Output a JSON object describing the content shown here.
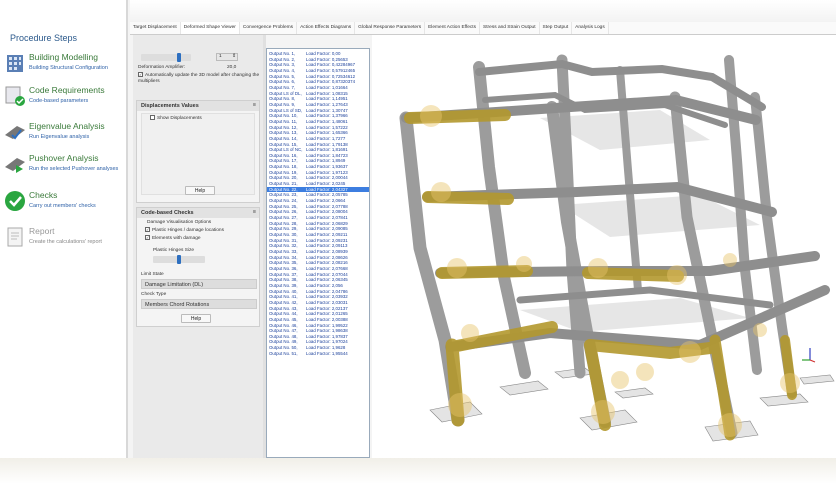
{
  "sidebar": {
    "title": "Procedure Steps",
    "steps": [
      {
        "title": "Building Modelling",
        "subtitle": "Building Structural Configuration",
        "icon": "building-icon"
      },
      {
        "title": "Code Requirements",
        "subtitle": "Code-based parameters",
        "icon": "code-document-icon"
      },
      {
        "title": "Eigenvalue Analysis",
        "subtitle": "Run Eigenvalue analysis",
        "icon": "eigenvalue-icon"
      },
      {
        "title": "Pushover Analysis",
        "subtitle": "Run the selected Pushover analyses",
        "icon": "pushover-icon"
      },
      {
        "title": "Checks",
        "subtitle": "Carry out members' checks",
        "icon": "check-icon"
      },
      {
        "title": "Report",
        "subtitle": "Create the calculations' report",
        "icon": "report-icon"
      }
    ]
  },
  "tabs": [
    "Target Displacement",
    "Deformed Shape Viewer",
    "Convergence Problems",
    "Action Effects Diagrams",
    "Global Response Parameters",
    "Element Action Effects",
    "Stress and Strain Output",
    "Step Output",
    "Analysis Logs"
  ],
  "active_tab": 1,
  "deformation": {
    "spinner_value": "1",
    "label": "Deformation Amplifier:",
    "value": "20,0",
    "auto_update": "Automatically update the 3D model after changing the multipliers"
  },
  "displacements": {
    "title": "Displacements Values",
    "show_label": "Show Displacements",
    "help": "Help"
  },
  "checks": {
    "title": "Code-based Checks",
    "options_label": "Damage Visualisation Options",
    "opt1": "Plastic Hinges / damage locations",
    "opt2": "Elements with damage",
    "size_label": "Plastic Hinges Size",
    "limit_state_label": "Limit State",
    "limit_state": "Damage Limitation (DL)",
    "check_type_label": "Check Type",
    "check_type": "Members Chord Rotations",
    "help": "Help",
    "collapse": "≡"
  },
  "output_list": {
    "selected": 24,
    "items": [
      [
        "Output No.   1,",
        "Load Factor: 0,00"
      ],
      [
        "Output No.   2,",
        "Load Factor: 0,25653"
      ],
      [
        "Output No.   3,",
        "Load Factor: 0,42284967"
      ],
      [
        "Output No.   4,",
        "Load Factor: 0,57912465"
      ],
      [
        "Output No.   5,",
        "Load Factor: 0,72534612"
      ],
      [
        "Output No.   6,",
        "Load Factor: 0,87320374"
      ],
      [
        "Output No.   7,",
        "Load Factor: 1,01664"
      ],
      [
        "Output LS of DL,",
        "Load Factor: 1,08315"
      ],
      [
        "Output No.   8,",
        "Load Factor: 1,14951"
      ],
      [
        "Output No.   9,",
        "Load Factor: 1,27643"
      ],
      [
        "Output LS of SD,",
        "Load Factor: 1,30747"
      ],
      [
        "Output No.  10,",
        "Load Factor: 1,37966"
      ],
      [
        "Output No.  11,",
        "Load Factor: 1,48061"
      ],
      [
        "Output No.  12,",
        "Load Factor: 1,57222"
      ],
      [
        "Output No.  13,",
        "Load Factor: 1,65366"
      ],
      [
        "Output No.  14,",
        "Load Factor: 1,7277"
      ],
      [
        "Output No.  15,",
        "Load Factor: 1,79138"
      ],
      [
        "Output LS of NC,",
        "Load Factor: 1,81691"
      ],
      [
        "Output No.  16,",
        "Load Factor: 1,84723"
      ],
      [
        "Output No.  17,",
        "Load Factor: 1,8949"
      ],
      [
        "Output No.  18,",
        "Load Factor: 1,93637"
      ],
      [
        "Output No.  19,",
        "Load Factor: 1,97123"
      ],
      [
        "Output No.  20,",
        "Load Factor: 2,00044"
      ],
      [
        "Output No.  21,",
        "Load Factor: 2,0245"
      ],
      [
        "Output No.  22,",
        "Load Factor: 2,04327"
      ],
      [
        "Output No.  23,",
        "Load Factor: 2,05785"
      ],
      [
        "Output No.  24,",
        "Load Factor: 2,0664"
      ],
      [
        "Output No.  25,",
        "Load Factor: 2,07788"
      ],
      [
        "Output No.  26,",
        "Load Factor: 2,08004"
      ],
      [
        "Output No.  27,",
        "Load Factor: 2,07841"
      ],
      [
        "Output No.  28,",
        "Load Factor: 2,06829"
      ],
      [
        "Output No.  29,",
        "Load Factor: 2,09085"
      ],
      [
        "Output No.  30,",
        "Load Factor: 2,09211"
      ],
      [
        "Output No.  31,",
        "Load Factor: 2,09231"
      ],
      [
        "Output No.  32,",
        "Load Factor: 2,09113"
      ],
      [
        "Output No.  33,",
        "Load Factor: 2,08939"
      ],
      [
        "Output No.  34,",
        "Load Factor: 2,08626"
      ],
      [
        "Output No.  35,",
        "Load Factor: 2,08216"
      ],
      [
        "Output No.  36,",
        "Load Factor: 2,07668"
      ],
      [
        "Output No.  37,",
        "Load Factor: 2,07044"
      ],
      [
        "Output No.  38,",
        "Load Factor: 2,06345"
      ],
      [
        "Output No.  39,",
        "Load Factor: 2,056"
      ],
      [
        "Output No.  40,",
        "Load Factor: 2,04786"
      ],
      [
        "Output No.  41,",
        "Load Factor: 2,03932"
      ],
      [
        "Output No.  42,",
        "Load Factor: 2,03031"
      ],
      [
        "Output No.  43,",
        "Load Factor: 2,02137"
      ],
      [
        "Output No.  44,",
        "Load Factor: 2,01265"
      ],
      [
        "Output No.  45,",
        "Load Factor: 2,00388"
      ],
      [
        "Output No.  46,",
        "Load Factor: 1,99522"
      ],
      [
        "Output No.  47,",
        "Load Factor: 1,98638"
      ],
      [
        "Output No.  48,",
        "Load Factor: 1,97837"
      ],
      [
        "Output No.  49,",
        "Load Factor: 1,97024"
      ],
      [
        "Output No.  50,",
        "Load Factor: 1,9628"
      ],
      [
        "Output No.  51,",
        "Load Factor: 1,95544"
      ]
    ]
  },
  "colors": {
    "accent": "#2d6fc0",
    "title_green": "#3a7a3a",
    "hinge": "#c9a22a",
    "concrete": "#a9a9a9"
  }
}
